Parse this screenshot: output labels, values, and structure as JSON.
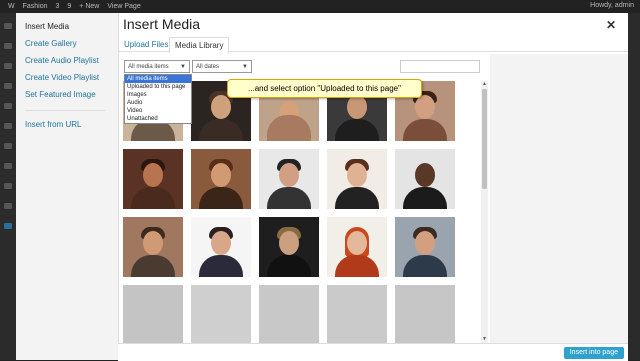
{
  "adminbar": {
    "items": [
      "Fashion",
      "3",
      "9",
      "+ New",
      "View Page"
    ],
    "howdy": "Howdy, admin"
  },
  "modal": {
    "title": "Insert Media",
    "close_icon": "close-icon",
    "menu": [
      "Insert Media",
      "Create Gallery",
      "Create Audio Playlist",
      "Create Video Playlist",
      "Set Featured Image",
      "Insert from URL"
    ],
    "tabs": [
      "Upload Files",
      "Media Library"
    ],
    "filter": {
      "selected": "All media items",
      "dates": "All dates"
    },
    "dropdown_options": [
      "All media items",
      "Uploaded to this page",
      "Images",
      "Audio",
      "Video",
      "Unattached"
    ],
    "tooltip": "...and select option \"Uploaded to this page\"",
    "footer": {
      "insert_label": "Insert into page"
    }
  },
  "thumbnails": [
    "model-hat",
    "woman-sunglasses",
    "woman-lying",
    "man-suit",
    "woman-pose",
    "woman-closeup",
    "woman-hand",
    "man-face",
    "woman-smile",
    "man-suit-dark",
    "man-glasses",
    "man-jacket",
    "man-blond",
    "woman-redhead",
    "man-smile",
    "logo-ludve",
    "logo-pocca",
    "logo-desire",
    "logo-terra",
    "logo-amilton"
  ],
  "colors": {
    "accent": "#2ea2cc",
    "link": "#21759b",
    "tooltip_bg": "#ffffcc"
  }
}
